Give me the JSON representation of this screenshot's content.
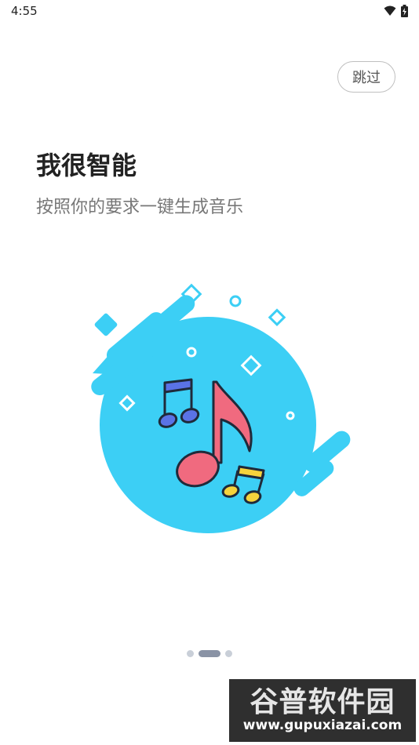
{
  "status_bar": {
    "time": "4:55"
  },
  "skip_label": "跳过",
  "title": "我很智能",
  "subtitle": "按照你的要求一键生成音乐",
  "page_indicator": {
    "count": 3,
    "active_index": 1
  },
  "watermark": {
    "name": "谷普软件园",
    "url": "www.gupuxiazai.com"
  },
  "colors": {
    "circle": "#3ccff5",
    "note_red": "#f06a7f",
    "note_blue": "#5a73e6",
    "note_yellow": "#f6d33c"
  }
}
